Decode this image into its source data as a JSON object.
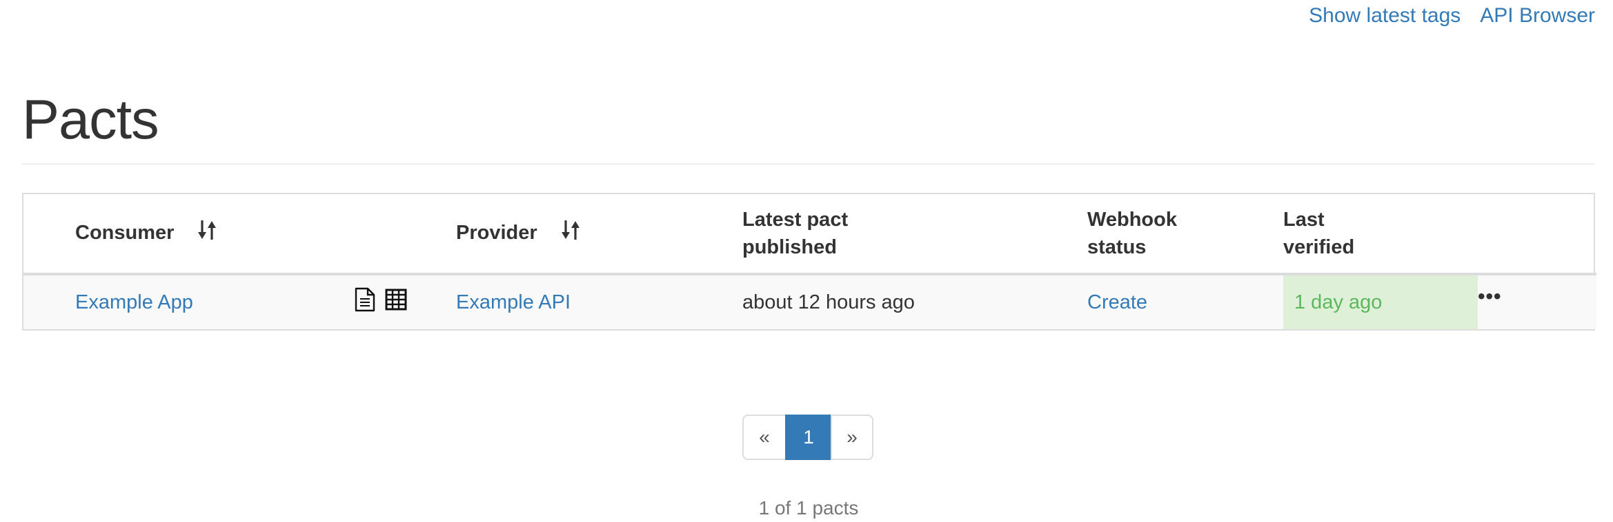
{
  "nav": {
    "show_latest_tags": "Show latest tags",
    "api_browser": "API Browser"
  },
  "page": {
    "title": "Pacts"
  },
  "table": {
    "headers": {
      "consumer": "Consumer",
      "provider": "Provider",
      "latest_pact_line1": "Latest pact",
      "latest_pact_line2": "published",
      "webhook_line1": "Webhook",
      "webhook_line2": "status",
      "last_verified_line1": "Last",
      "last_verified_line2": "verified"
    },
    "rows": [
      {
        "consumer": "Example App",
        "provider": "Example API",
        "latest_pact_published": "about 12 hours ago",
        "webhook_status": "Create",
        "last_verified": "1 day ago",
        "menu": "•••"
      }
    ]
  },
  "pagination": {
    "prev": "«",
    "current": "1",
    "next": "»"
  },
  "summary": "1 of 1 pacts",
  "colors": {
    "link": "#337ab7",
    "verified_bg": "#dff0d8",
    "verified_text": "#5cb85c",
    "active_page": "#337ab7"
  },
  "icons": [
    "sort-icon",
    "document-icon",
    "table-grid-icon",
    "ellipsis-icon"
  ]
}
